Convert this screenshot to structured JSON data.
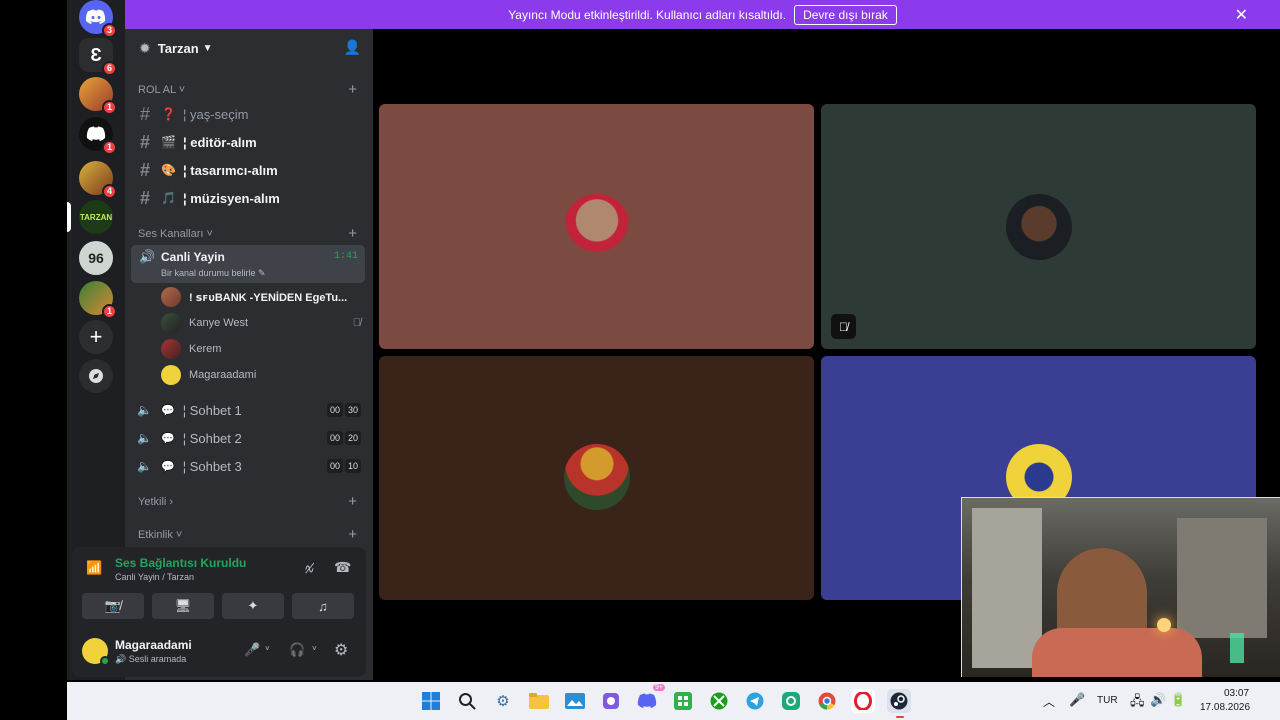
{
  "banner": {
    "text": "Yayıncı Modu etkinleştirildi. Kullanıcı adları kısaltıldı.",
    "button": "Devre dışı bırak"
  },
  "rail_badges": [
    "3",
    "6",
    "1",
    "1",
    "4",
    "1"
  ],
  "server": {
    "name": "Tarzan"
  },
  "categories": {
    "rol_al": "ROL AL",
    "ses": "Ses Kanalları",
    "yetkili": "Yetkili",
    "etkinlik": "Etkinlik"
  },
  "text_channels": [
    {
      "emoji": "❓",
      "name": "¦ yaş-seçim"
    },
    {
      "emoji": "🎬",
      "name": "¦ editör-alım"
    },
    {
      "emoji": "🎨",
      "name": "¦ tasarımcı-alım"
    },
    {
      "emoji": "🎵",
      "name": "¦ müzisyen-alım"
    }
  ],
  "live_channel": {
    "name": "Canli Yayin",
    "status": "Bir kanal durumu belirle",
    "time": "1:41"
  },
  "voice_members": [
    "! ꜱꜰᴜBANK -YENİDEN EgeTu...",
    "Kanye West",
    "Kerem",
    "Magaraadami"
  ],
  "voice_channels": [
    {
      "name": "¦ Sohbet 1",
      "count": "00",
      "limit": "30"
    },
    {
      "name": "¦ Sohbet 2",
      "count": "00",
      "limit": "20"
    },
    {
      "name": "¦ Sohbet 3",
      "count": "00",
      "limit": "10"
    }
  ],
  "voice_panel": {
    "title": "Ses Bağlantısı Kuruldu",
    "subtitle": "Canli Yayin / Tarzan"
  },
  "user": {
    "name": "Magaraadami",
    "status": "Sesli aramada"
  },
  "taskbar": {
    "lang": "TUR",
    "time": "03:07",
    "date": "17.08.2026",
    "discord_badge": "9+"
  },
  "colors": {
    "banner": "#8b3bec",
    "tile1": "#7b4a40",
    "tile2": "#2d3a36",
    "tile3": "#3a2319",
    "tile4": "#3b3f94",
    "connected": "#23a55a"
  }
}
